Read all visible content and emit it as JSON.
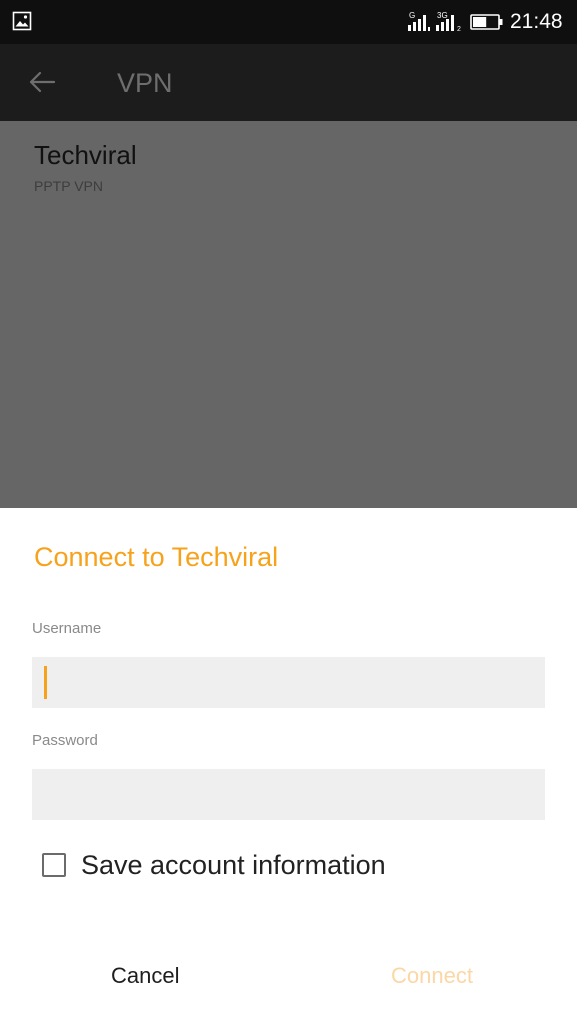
{
  "status_bar": {
    "time": "21:48",
    "icons": [
      "gallery-icon",
      "signal-g-icon",
      "signal-3g-icon",
      "battery-icon"
    ],
    "signal_1_label": "G",
    "signal_2_label": "3G",
    "signal_2_sub": "2",
    "battery_level": 0.55
  },
  "app_bar": {
    "title": "VPN",
    "back_icon": "arrow-left-icon"
  },
  "vpn_list": {
    "items": [
      {
        "name": "Techviral",
        "type": "PPTP VPN"
      }
    ]
  },
  "dialog": {
    "title": "Connect to Techviral",
    "username_label": "Username",
    "username_value": "",
    "password_label": "Password",
    "password_value": "",
    "save_label": "Save account information",
    "save_checked": false,
    "cancel_label": "Cancel",
    "connect_label": "Connect"
  },
  "colors": {
    "accent": "#f7a21b",
    "accent_disabled": "#fbd7a6",
    "scrim": "#666666",
    "status_bar": "#0f0f0f",
    "app_bar": "#1c1c1c"
  }
}
